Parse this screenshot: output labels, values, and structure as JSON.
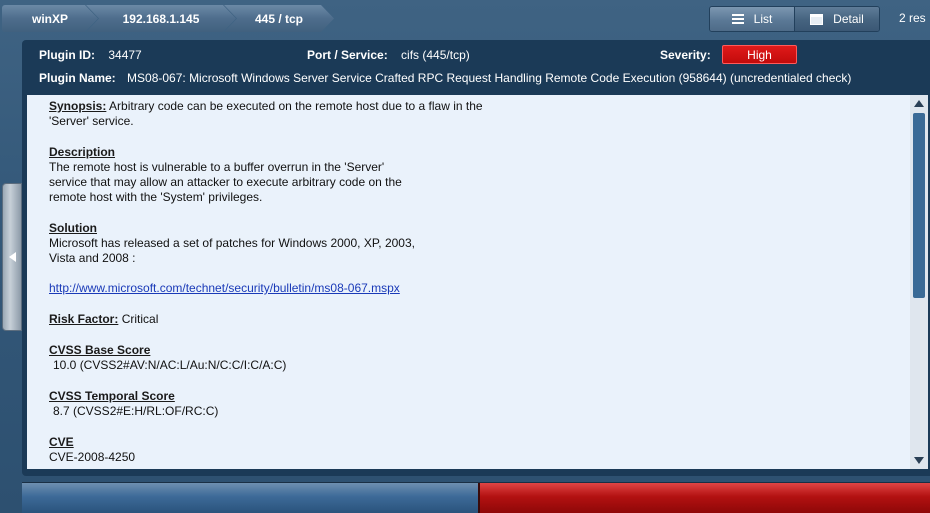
{
  "breadcrumb": {
    "host_group": "winXP",
    "host": "192.168.1.145",
    "port": "445 / tcp"
  },
  "view_toggle": {
    "list_label": "List",
    "detail_label": "Detail"
  },
  "result_count": "2  res",
  "plugin": {
    "id_label": "Plugin ID:",
    "id_value": "34477",
    "port_label": "Port / Service:",
    "port_value": "cifs (445/tcp)",
    "severity_label": "Severity:",
    "severity_value": "High",
    "name_label": "Plugin Name:",
    "name_value": "MS08-067: Microsoft Windows Server Service Crafted RPC Request Handling Remote Code Execution (958644) (uncredentialed check)"
  },
  "details": {
    "synopsis_label": "Synopsis:",
    "synopsis_text": "Arbitrary code can be executed on the remote host due to a flaw in the",
    "synopsis_text2": "'Server' service.",
    "description_label": "Description",
    "description_text": "The remote host is vulnerable to a buffer overrun in the 'Server'\nservice that may allow an attacker to execute arbitrary code on the\nremote host with the 'System' privileges.",
    "solution_label": "Solution",
    "solution_text": "Microsoft has released a set of patches for Windows 2000, XP, 2003,\nVista and 2008 :",
    "solution_link": "http://www.microsoft.com/technet/security/bulletin/ms08-067.mspx",
    "risk_label": "Risk Factor:",
    "risk_value": "Critical",
    "cvss_base_label": "CVSS Base Score",
    "cvss_base_value": "10.0 (CVSS2#AV:N/AC:L/Au:N/C:C/I:C/A:C)",
    "cvss_temporal_label": "CVSS Temporal Score",
    "cvss_temporal_value": "8.7 (CVSS2#E:H/RL:OF/RC:C)",
    "cve_label": "CVE",
    "cve_value": "CVE-2008-4250"
  },
  "colors": {
    "severity_high": "#c20b0b",
    "panel_bg": "#1b3a57",
    "content_bg": "#eaf2fb"
  }
}
